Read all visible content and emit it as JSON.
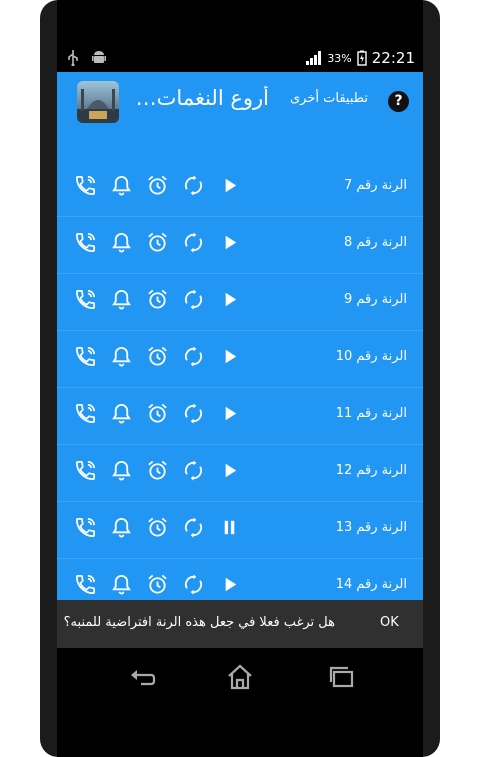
{
  "status_bar": {
    "battery_percent": "33%",
    "time": "22:21"
  },
  "app_bar": {
    "title": "أروع النغمات الا...",
    "other_apps_label": "تطبيقات أخرى",
    "help_label": "?"
  },
  "rows": [
    {
      "label": "الرنة رقم 7",
      "state": "play"
    },
    {
      "label": "الرنة رقم 8",
      "state": "play"
    },
    {
      "label": "الرنة رقم 9",
      "state": "play"
    },
    {
      "label": "الرنة رقم 10",
      "state": "play"
    },
    {
      "label": "الرنة رقم 11",
      "state": "play"
    },
    {
      "label": "الرنة رقم 12",
      "state": "play"
    },
    {
      "label": "الرنة رقم 13",
      "state": "pause"
    },
    {
      "label": "الرنة رقم 14",
      "state": "play"
    }
  ],
  "snackbar": {
    "message": "هل ترغب فعلا في جعل هذه الرنة افتراضية للمنبه؟",
    "action": "OK"
  },
  "row_icons": [
    "ringtone-phone-icon",
    "notification-bell-icon",
    "alarm-clock-icon",
    "repeat-icon",
    "play-pause-icon"
  ],
  "nav_icons": [
    "back-icon",
    "home-icon",
    "recent-apps-icon"
  ]
}
